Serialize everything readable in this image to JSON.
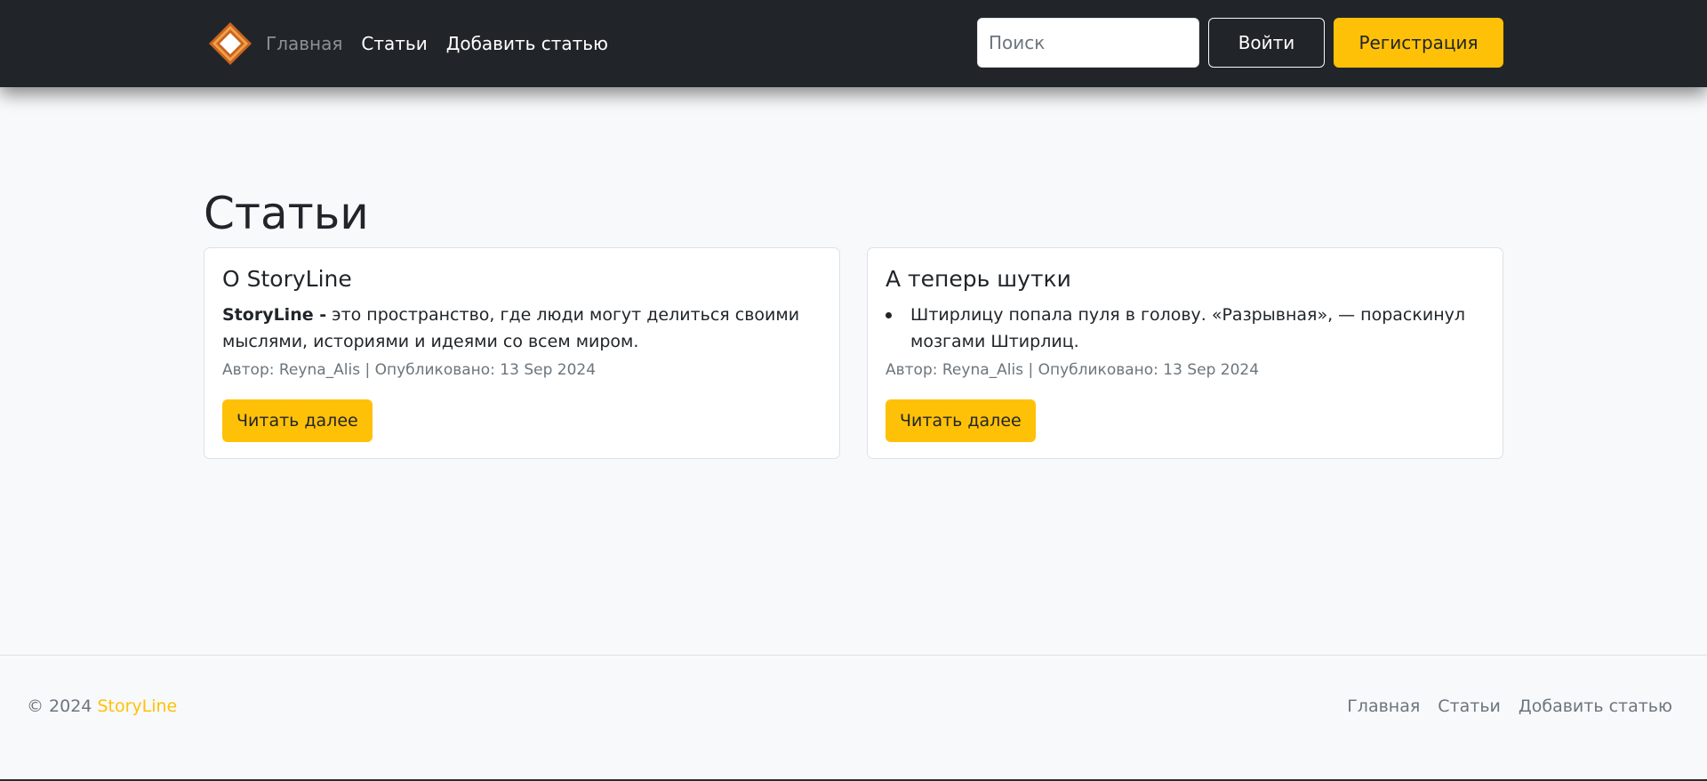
{
  "navbar": {
    "logo": "diamond-logo-icon",
    "links": [
      {
        "label": "Главная",
        "active": true
      },
      {
        "label": "Статьи",
        "active": false
      },
      {
        "label": "Добавить статью",
        "active": false
      }
    ],
    "search": {
      "placeholder": "Поиск",
      "value": ""
    },
    "login_label": "Войти",
    "register_label": "Регистрация"
  },
  "main": {
    "title": "Статьи",
    "cards": [
      {
        "title": "О StoryLine",
        "text_bold": "StoryLine -",
        "text": " это пространство, где люди могут делиться своими мыслями, историями и идеями со всем миром.",
        "meta": "Автор: Reyna_Alis | Опубликовано: 13 Sep 2024",
        "button_label": "Читать далее"
      },
      {
        "title": "А теперь шутки",
        "list_item": "Штирлицу попала пуля в голову. «Разрывная», — пораскинул мозгами Штирлиц.",
        "meta": "Автор: Reyna_Alis | Опубликовано: 13 Sep 2024",
        "button_label": "Читать далее"
      }
    ]
  },
  "footer": {
    "copyright_prefix": "© 2024",
    "brand": "StoryLine",
    "links": [
      "Главная",
      "Статьи",
      "Добавить статью"
    ]
  },
  "colors": {
    "navbar_bg": "#212529",
    "accent": "#ffc107",
    "page_bg": "#f8f9fa",
    "muted": "#6c757d"
  }
}
